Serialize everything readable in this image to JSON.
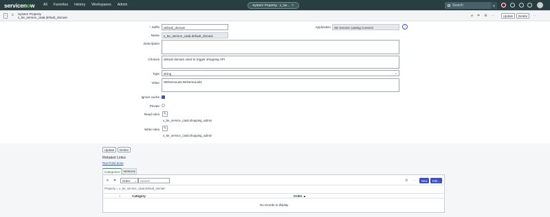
{
  "nav": {
    "logo_a": "servicen",
    "logo_b": "o",
    "logo_c": "w",
    "items": [
      "All",
      "Favorites",
      "History",
      "Workspaces",
      "Admin"
    ],
    "context_title": "System Property - x_5e...",
    "search_placeholder": "Search"
  },
  "header": {
    "record_type": "System Property",
    "record_name": "x_5e_service_catal.default_domain",
    "update_label": "Update",
    "delete_label": "Delete"
  },
  "form": {
    "suffix_label": "Suffix",
    "suffix_value": "default_domain",
    "application_label": "Application",
    "application_value": "SE Service catalog Connect",
    "name_label": "Name",
    "name_value": "x_5e_service_catal.default_domain",
    "description_label": "Description",
    "description_value": "",
    "choices_label": "Choices",
    "choices_value": "default domain used to trigger shopping API",
    "type_label": "Type",
    "type_value": "string",
    "value_label": "Value",
    "value_value": "SEDemoLab;SEDemoLab1",
    "ignore_cache_label": "Ignore cache",
    "ignore_cache_checked": true,
    "private_label": "Private",
    "read_roles_label": "Read roles",
    "read_roles_value": "x_5e_service_catal.shopping_admin",
    "write_roles_label": "Write roles",
    "write_roles_value": "x_5e_service_catal.shopping_admin"
  },
  "footer": {
    "update_label": "Update",
    "delete_label": "Delete",
    "related_links_label": "Related Links",
    "run_point_scan_label": "Run Point Scan"
  },
  "related_list": {
    "tabs": [
      "Categories",
      "Versions"
    ],
    "order_select": "Order",
    "search_placeholder": "Search",
    "new_label": "New",
    "edit_label": "Edit...",
    "breadcrumb": "Property = x_5e_service_catal.default_domain",
    "columns": [
      "Category",
      "Order ▲"
    ],
    "empty_message": "No records to display"
  },
  "colors": {
    "topbar": "#293e40",
    "accent_button": "#3b4ec7",
    "logo_green": "#62d84e"
  }
}
